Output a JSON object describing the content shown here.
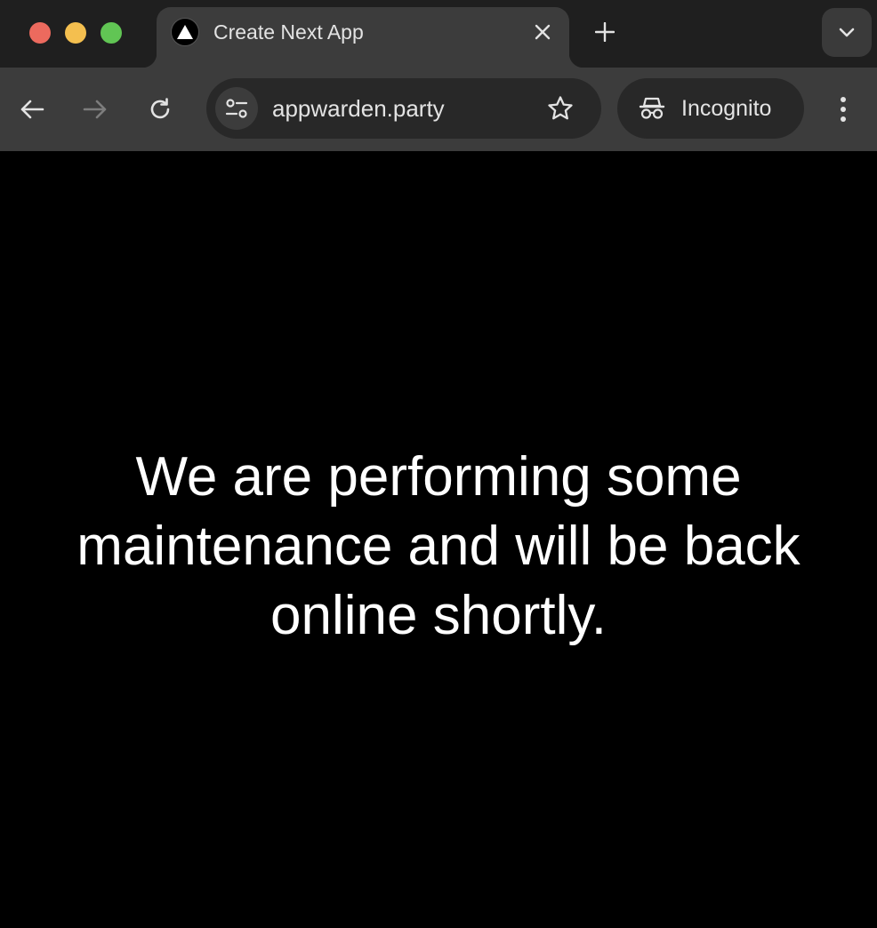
{
  "browser": {
    "tab": {
      "title": "Create Next App",
      "favicon": "nextjs-triangle-icon"
    },
    "address_bar": {
      "url": "appwarden.party"
    },
    "profile": {
      "label": "Incognito"
    }
  },
  "page": {
    "message": "We are performing some maintenance and will be back online shortly."
  },
  "colors": {
    "tabstrip": "#1f1f1f",
    "toolbar": "#3c3c3c",
    "omnibox": "#282828",
    "page_background": "#000000",
    "page_text": "#ffffff",
    "traffic_close": "#ec6a5e",
    "traffic_minimize": "#f4bf4f",
    "traffic_zoom": "#61c554"
  }
}
